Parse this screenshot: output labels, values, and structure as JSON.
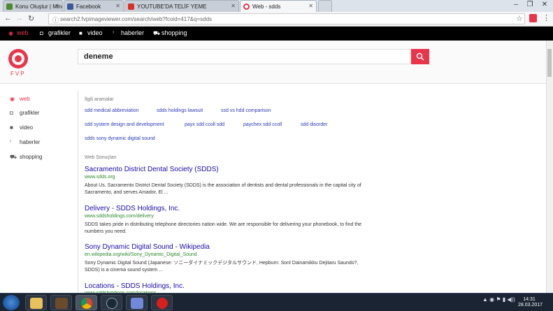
{
  "browser": {
    "tabs": [
      {
        "label": "Konu Oluştur | Minecraft",
        "color": "#4d8a2e"
      },
      {
        "label": "Facebook",
        "color": "#3b5998"
      },
      {
        "label": "YOUTUBE'DA TELİF YEME",
        "color": "#d93025"
      },
      {
        "label": "Web - sdds",
        "color": "#e8354a",
        "active": true
      }
    ],
    "url": "search2.fvpimageviewer.com/search/web?fcoid=417&q=sdds"
  },
  "sitenav": {
    "items": [
      {
        "label": "web",
        "icon": "circle-target-icon",
        "active": true
      },
      {
        "label": "grafikler",
        "icon": "camera-icon"
      },
      {
        "label": "video",
        "icon": "video-icon"
      },
      {
        "label": "haberler",
        "icon": "rss-icon"
      },
      {
        "label": "shopping",
        "icon": "cart-icon"
      }
    ]
  },
  "logo": {
    "text": "FVP",
    "accent": "#e8354a"
  },
  "search": {
    "value": "deneme"
  },
  "sidebar": {
    "items": [
      {
        "label": "web",
        "active": true
      },
      {
        "label": "grafikler"
      },
      {
        "label": "video"
      },
      {
        "label": "haberler"
      },
      {
        "label": "shopping"
      }
    ]
  },
  "related": {
    "heading": "İlgili aramalar",
    "rows": [
      [
        "sdd medical abbreviation",
        "sdds holdings lawsuit",
        "ssd vs hdd comparison"
      ],
      [
        "sdd system design and development",
        "payx sdd ccoll sdd",
        "paychex sdd ccoll",
        "sdd disorder"
      ],
      [
        "sdds sony dynamic digital sound"
      ]
    ]
  },
  "results": {
    "heading": "Web Sonuçları",
    "items": [
      {
        "title": "Sacramento District Dental Society (SDDS)",
        "url": "www.sdds.org",
        "desc": "About Us. Sacramento District Dental Society (SDDS) is the association of dentists and dental professionals in the capital city of Sacramento, and serves Amador, El ..."
      },
      {
        "title": "Delivery - SDDS Holdings, Inc.",
        "url": "www.sddsholdings.com/delivery",
        "desc": "SDDS takes pride in distributing telephone directories nation wide. We are responsible for delivering your phonebook, to find the numbers you need."
      },
      {
        "title": "Sony Dynamic Digital Sound - Wikipedia",
        "url": "en.wikipedia.org/wiki/Sony_Dynamic_Digital_Sound",
        "desc": "Sony Dynamic Digital Sound (Japanese: ソニーダイナミックデジタルサウンド, Hepburn: Sonī Dainamikku Dejitaru Saundo?, SDDS) is a cinema sound system ..."
      },
      {
        "title": "Locations - SDDS Holdings, Inc.",
        "url": "www.sddsholdings.com/locations",
        "desc": ""
      }
    ]
  },
  "taskbar": {
    "time": "14:31",
    "date": "28.03.2017"
  }
}
